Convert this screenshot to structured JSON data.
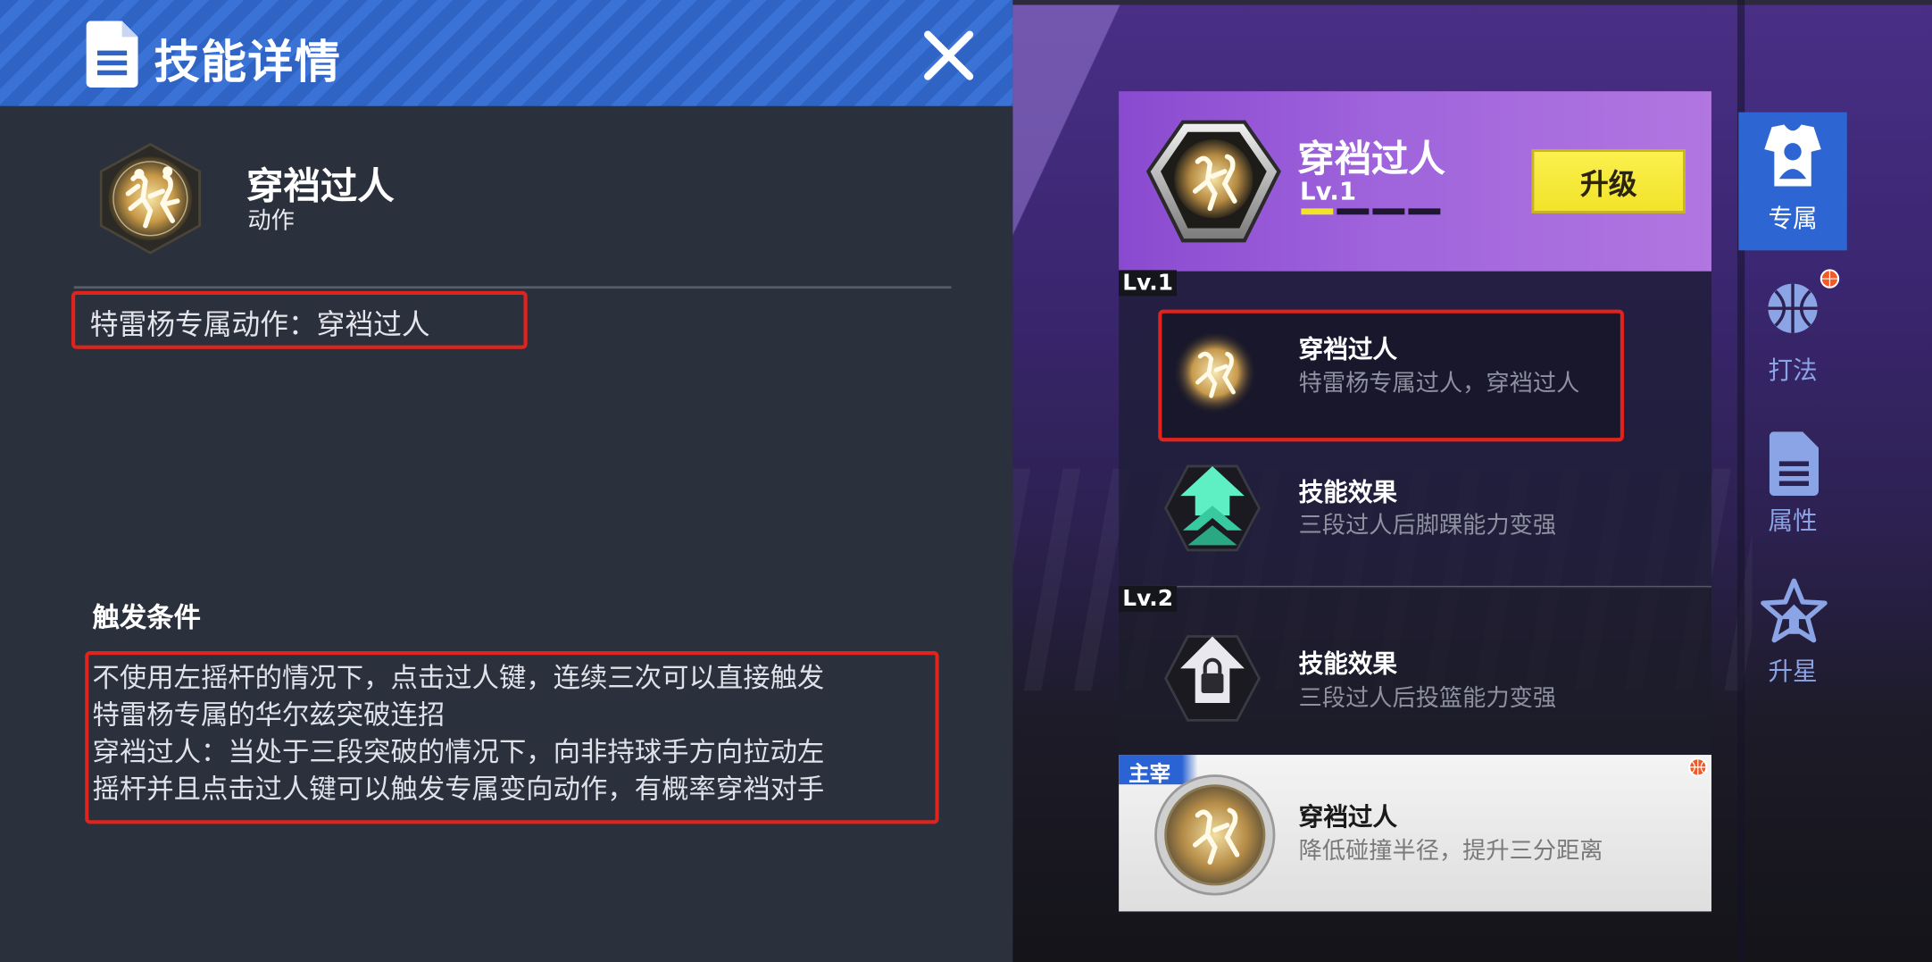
{
  "left_panel": {
    "title": "技能详情",
    "skill_name": "穿裆过人",
    "skill_type": "动作",
    "exclusive_note": "特雷杨专属动作：穿裆过人",
    "trigger_heading": "触发条件",
    "trigger_lines": [
      "不使用左摇杆的情况下，点击过人键，连续三次可以直接触发",
      "特雷杨专属的华尔兹突破连招",
      "穿裆过人：当处于三段突破的情况下，向非持球手方向拉动左",
      "摇杆并且点击过人键可以触发专属变向动作，有概率穿裆对手"
    ]
  },
  "skill_card": {
    "name": "穿裆过人",
    "level": "Lv.1",
    "level_progress": 0.25,
    "upgrade_label": "升级"
  },
  "levels": {
    "lv1_tag": "Lv.1",
    "lv2_tag": "Lv.2",
    "rows": [
      {
        "title": "穿裆过人",
        "desc": "特雷杨专属过人，穿裆过人"
      },
      {
        "title": "技能效果",
        "desc": "三段过人后脚踝能力变强"
      },
      {
        "title": "技能效果",
        "desc": "三段过人后投篮能力变强"
      }
    ]
  },
  "bottom_card": {
    "tag": "主宰",
    "title": "穿裆过人",
    "desc": "降低碰撞半径，提升三分距离"
  },
  "side_tabs": [
    {
      "label": "专属",
      "active": true
    },
    {
      "label": "打法",
      "active": false
    },
    {
      "label": "属性",
      "active": false
    },
    {
      "label": "升星",
      "active": false
    }
  ],
  "colors": {
    "header_blue": "#2f63c4",
    "highlight_red": "#e0231d",
    "card_purple": "#a064dc",
    "upgrade_yellow": "#f2e32a",
    "tab_active_blue": "#2d66d2",
    "tab_inactive": "#8aa4e6"
  },
  "icons": [
    "document-icon",
    "close-icon",
    "skill-emblem-icon",
    "chevron-up-icon",
    "lock-icon",
    "jersey-icon",
    "basketball-icon",
    "star-icon"
  ]
}
